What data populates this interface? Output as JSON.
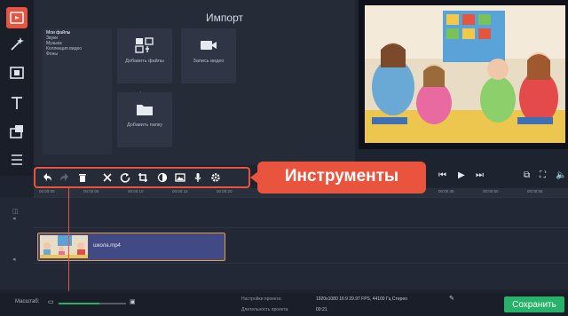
{
  "colors": {
    "accent": "#e8543d",
    "save": "#27b26a",
    "clip": "#414a85"
  },
  "rail": {
    "icons": [
      "import-icon",
      "magic-wand-icon",
      "transitions-icon",
      "text-icon",
      "clip-export-icon",
      "list-icon"
    ]
  },
  "import_panel": {
    "title": "Импорт",
    "categories": [
      "Мои файлы",
      "Звуки",
      "Музыка",
      "Коллекция видео",
      "Фоны"
    ],
    "tiles": {
      "add_files": "Добавить файлы",
      "record_video": "Запись видео",
      "add_folder": "Добавить папку"
    }
  },
  "callout": {
    "text": "Инструменты"
  },
  "ruler": {
    "ticks": [
      "00:00:00",
      "00:00:05",
      "00:00:10",
      "00:00:15",
      "00:00:20",
      "00:00:25",
      "00:00:30",
      "00:00:35",
      "00:00:40",
      "00:00:45",
      "00:00:50",
      "00:00:55"
    ]
  },
  "timeline": {
    "clip_name": "школа.mp4"
  },
  "bottom": {
    "scale_label": "Масштаб:",
    "zoom_level": 0.6,
    "project_settings_label": "Настройки проекта:",
    "project_settings_value": "1920x1080 16:9 29.97 FPS, 44100 Гц Стерео",
    "duration_label": "Длительность проекта:",
    "duration_value": "00:21",
    "save_label": "Сохранить"
  }
}
